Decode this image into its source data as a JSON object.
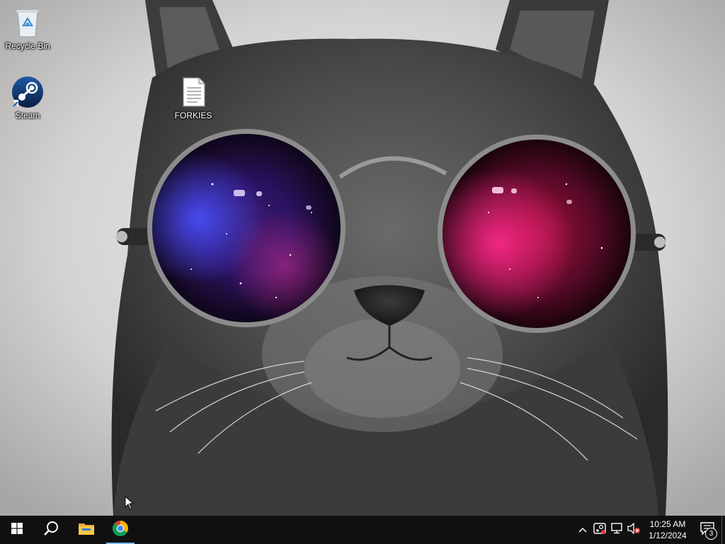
{
  "desktop": {
    "icons": [
      {
        "label": "Recycle Bin",
        "icon": "recycle-bin-icon"
      },
      {
        "label": "Steam",
        "icon": "steam-icon"
      },
      {
        "label": "FORKIES",
        "icon": "text-file-icon"
      }
    ],
    "wallpaper": "cat-with-galaxy-sunglasses"
  },
  "taskbar": {
    "start_icon": "windows-logo-icon",
    "search_icon": "search-icon",
    "pinned": [
      {
        "name": "File Explorer",
        "icon": "folder-icon"
      },
      {
        "name": "Google Chrome",
        "icon": "chrome-icon"
      }
    ],
    "tray": {
      "icons": [
        "chevron-up-icon",
        "steam-tray-icon",
        "network-icon",
        "volume-muted-icon"
      ],
      "time": "10:25 AM",
      "date": "1/12/2024",
      "notification_count": "3"
    },
    "colors": {
      "background": "#101010",
      "text": "#ffffff"
    }
  }
}
